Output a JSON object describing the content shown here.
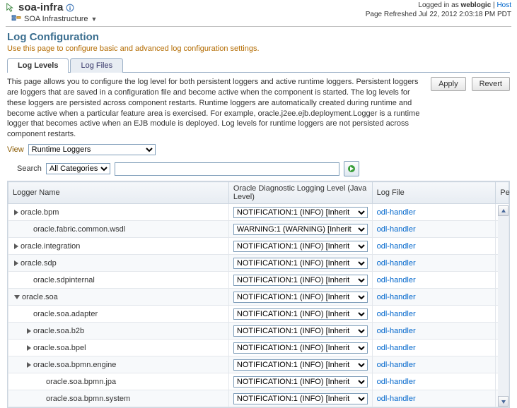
{
  "header": {
    "title": "soa-infra",
    "infra_label": "SOA Infrastructure",
    "login_prefix": "Logged in as",
    "login_user": "weblogic",
    "login_host": "Host",
    "refresh": "Page Refreshed Jul 22, 2012 2:03:18 PM PDT"
  },
  "page": {
    "title": "Log Configuration",
    "hint": "Use this page to configure basic and advanced log configuration settings.",
    "tabs": {
      "levels": "Log Levels",
      "files": "Log Files"
    },
    "desc": "This page allows you to configure the log level for both persistent loggers and active runtime loggers. Persistent loggers are loggers that are saved in a configuration file and become active when the component is started. The log levels for these loggers are persisted across component restarts. Runtime loggers are automatically created during runtime and become active when a particular feature area is exercised. For example, oracle.j2ee.ejb.deployment.Logger is a runtime logger that becomes active when an EJB module is deployed. Log levels for runtime loggers are not persisted across component restarts.",
    "apply": "Apply",
    "revert": "Revert",
    "view_label": "View",
    "view_value": "Runtime Loggers",
    "search_label": "Search",
    "search_cat": "All Categories",
    "search_value": ""
  },
  "table": {
    "headers": {
      "name": "Logger Name",
      "level": "Oracle Diagnostic Logging Level (Java Level)",
      "file": "Log File",
      "p": "Pe"
    },
    "level_default": "NOTIFICATION:1 (INFO) [Inherit",
    "level_warn": "WARNING:1 (WARNING) [Inherit",
    "logfile": "odl-handler",
    "rows": [
      {
        "indent": 0,
        "exp": "right",
        "name": "oracle.bpm",
        "lvl": "d"
      },
      {
        "indent": 1,
        "exp": "none",
        "name": "oracle.fabric.common.wsdl",
        "lvl": "w"
      },
      {
        "indent": 0,
        "exp": "right",
        "name": "oracle.integration",
        "lvl": "d"
      },
      {
        "indent": 0,
        "exp": "right",
        "name": "oracle.sdp",
        "lvl": "d"
      },
      {
        "indent": 1,
        "exp": "none",
        "name": "oracle.sdpinternal",
        "lvl": "d"
      },
      {
        "indent": 0,
        "exp": "down",
        "name": "oracle.soa",
        "lvl": "d"
      },
      {
        "indent": 1,
        "exp": "none",
        "name": "oracle.soa.adapter",
        "lvl": "d"
      },
      {
        "indent": 1,
        "exp": "right",
        "name": "oracle.soa.b2b",
        "lvl": "d"
      },
      {
        "indent": 1,
        "exp": "right",
        "name": "oracle.soa.bpel",
        "lvl": "d"
      },
      {
        "indent": 1,
        "exp": "right",
        "name": "oracle.soa.bpmn.engine",
        "lvl": "d"
      },
      {
        "indent": 2,
        "exp": "none",
        "name": "oracle.soa.bpmn.jpa",
        "lvl": "d"
      },
      {
        "indent": 2,
        "exp": "none",
        "name": "oracle.soa.bpmn.system",
        "lvl": "d"
      }
    ]
  }
}
